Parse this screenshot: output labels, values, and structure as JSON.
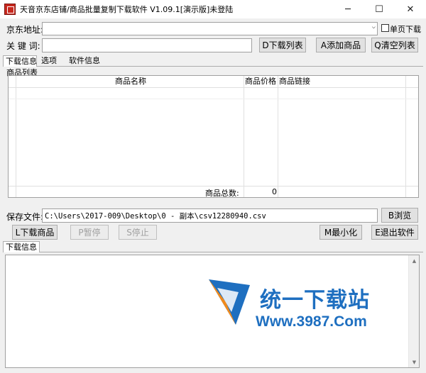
{
  "window": {
    "title": "天音京东店铺/商品批量复制下载软件 V1.09.1[演示版]未登陆",
    "min_glyph": "─",
    "max_glyph": "☐",
    "close_glyph": "✕"
  },
  "form": {
    "url_label": "京东地址:",
    "url_value": "",
    "single_page_label": "单页下载",
    "keyword_label": "关 键 词:",
    "keyword_value": "",
    "download_list_btn": "D下载列表",
    "add_product_btn": "A添加商品",
    "clear_list_btn": "Q清空列表"
  },
  "tabs": [
    "下载信息",
    "选项",
    "软件信息"
  ],
  "products": {
    "group_title": "商品列表",
    "columns": [
      "商品名称",
      "商品价格",
      "商品链接"
    ],
    "total_label": "商品总数:",
    "total_value": "0"
  },
  "save": {
    "label": "保存文件:",
    "path": "C:\\Users\\2017-009\\Desktop\\0 - 副本\\csv12280940.csv",
    "browse_btn": "B浏览"
  },
  "actions": {
    "download_btn": "L下载商品",
    "pause_btn": "P暂停",
    "stop_btn": "S停止",
    "minimize_btn": "M最小化",
    "exit_btn": "E退出软件"
  },
  "log": {
    "tab": "下载信息"
  },
  "watermark": {
    "brand": "统一下载站",
    "site": "Www.3987.Com"
  },
  "colors": {
    "watermark_blue": "#1e6fc0",
    "watermark_orange": "#f08a1c",
    "icon_red": "#c8281e"
  }
}
